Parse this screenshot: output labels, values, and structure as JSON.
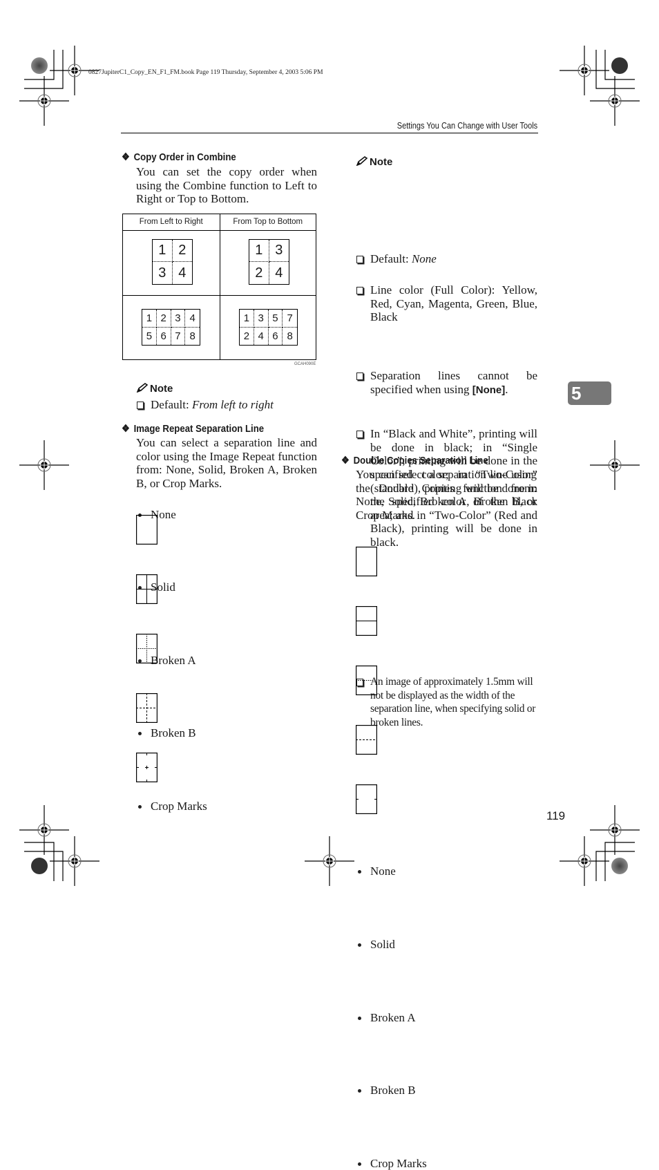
{
  "header": {
    "book_line": "0827JupiterC1_Copy_EN_F1_FM.book  Page 119  Thursday, September 4, 2003  5:06 PM",
    "running_head": "Settings You Can Change with User Tools"
  },
  "left": {
    "copy_order": {
      "heading": "Copy Order in Combine",
      "body": "You can set the copy order when using the Combine function to Left to Right or Top to Bottom.",
      "table": {
        "col1_header": "From Left to Right",
        "col2_header": "From Top to Bottom",
        "ltr_2x2": [
          "1",
          "2",
          "3",
          "4"
        ],
        "ttb_2x2": [
          "1",
          "3",
          "2",
          "4"
        ],
        "ltr_4x2": [
          "1",
          "2",
          "3",
          "4",
          "5",
          "6",
          "7",
          "8"
        ],
        "ttb_4x2": [
          "1",
          "3",
          "5",
          "7",
          "2",
          "4",
          "6",
          "8"
        ]
      },
      "figure_code": "GCAH090E",
      "note_title": "Note",
      "note_default_label": "Default: ",
      "note_default_value": "From left to right"
    },
    "image_repeat": {
      "heading": "Image Repeat Separation Line",
      "body": "You can select a separation line and color using the Image Repeat function from: None, Solid, Broken A, Broken B, or Crop Marks.",
      "options": [
        "None",
        "Solid",
        "Broken A",
        "Broken B",
        "Crop Marks"
      ]
    }
  },
  "right": {
    "note": {
      "title": "Note",
      "default_label": "Default: ",
      "default_value": "None",
      "item_line_color": "Line color (Full Color): Yellow, Red, Cyan, Magenta, Green, Blue, Black",
      "item_sep_pre": "Separation lines cannot be specified when using ",
      "item_sep_key": "[None]",
      "item_sep_post": ".",
      "item_bw": "In “Black and White”, printing will be done in black; in “Single Color”, printing will be done in the specified color; in “Two-Color” (standard), printing will be done in the specified color of the black area; and in “Two-Color” (Red and Black), printing will be done in black.",
      "item_width": "An image of approximately 1.5mm will not be displayed as the width of the separation line, when specifying solid or broken lines."
    },
    "double_copies": {
      "heading": "Double Copies Separation Line",
      "body": "You can select a separation line using the Double Copies function from: None, Solid, Broken A, Broken B, or Crop Marks.",
      "options": [
        "None",
        "Solid",
        "Broken A",
        "Broken B",
        "Crop Marks"
      ]
    }
  },
  "chapter_tab": "5",
  "page_number": "119"
}
